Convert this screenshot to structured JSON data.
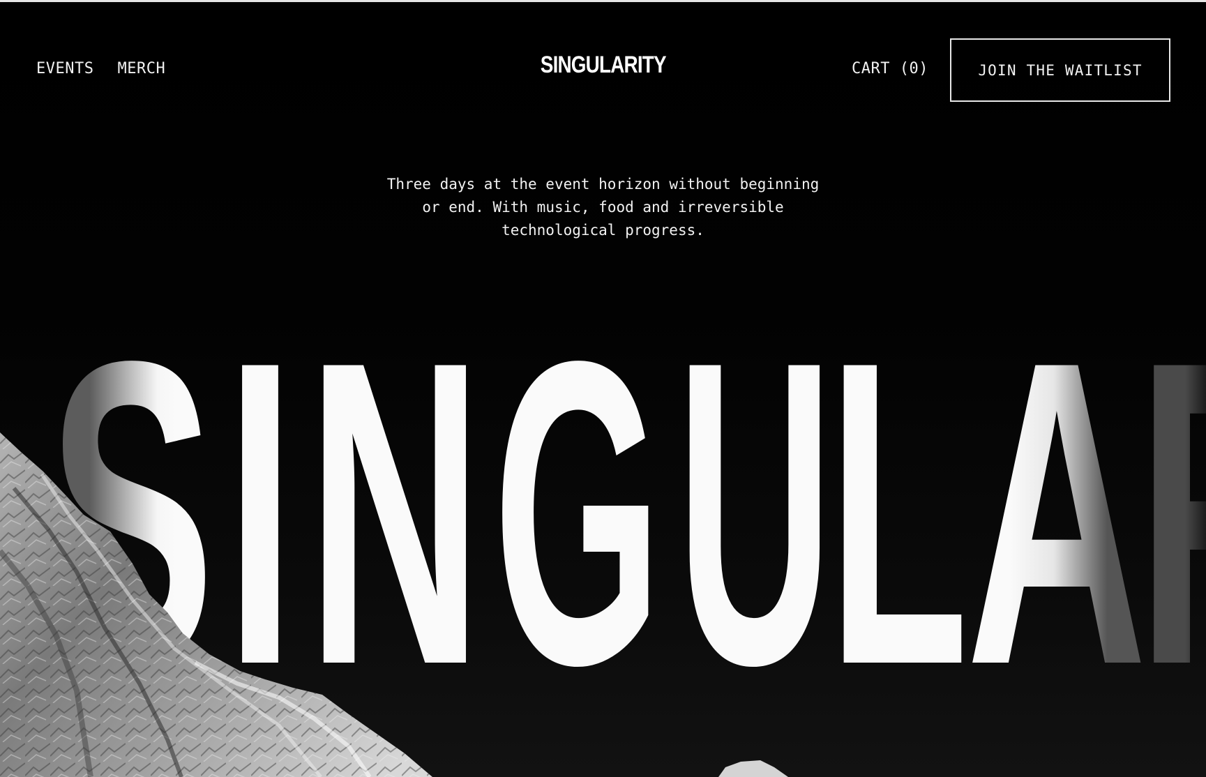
{
  "header": {
    "nav_links": [
      {
        "label": "EVENTS"
      },
      {
        "label": "MERCH"
      }
    ],
    "brand": "SINGULARITY",
    "cart_label": "CART (0)",
    "cta_label": "JOIN THE WAITLIST"
  },
  "hero": {
    "tagline_lines": [
      "Three days at the event horizon without beginning",
      "or end. With music, food and irreversible",
      "technological progress."
    ],
    "big_word": "SINGULAR",
    "image": "mountain-peak-grayscale"
  },
  "colors": {
    "background": "#000000",
    "text": "#f2f2f2",
    "accent_border": "#e8e8e8"
  }
}
